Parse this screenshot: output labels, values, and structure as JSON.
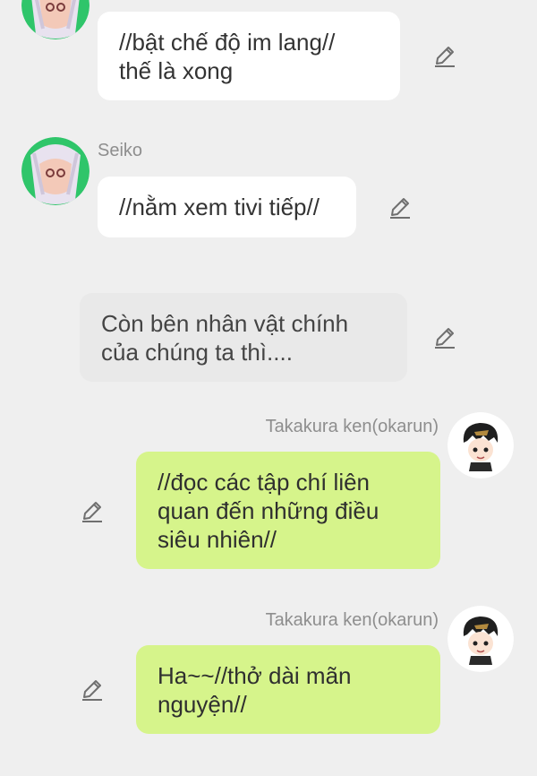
{
  "messages": [
    {
      "sender": "",
      "text": "//bật chế độ im lang//\nthế là xong"
    },
    {
      "sender": "Seiko",
      "text": "//nằm xem tivi tiếp//"
    },
    {
      "sender": "",
      "text": "Còn bên nhân vật chính\ncủa chúng ta thì...."
    },
    {
      "sender": "Takakura ken(okarun)",
      "text": "//đọc các tập chí liên\nquan đến những điều\nsiêu nhiên//"
    },
    {
      "sender": "Takakura ken(okarun)",
      "text": "Ha~~//thở dài mãn\nnguyện//"
    }
  ],
  "colors": {
    "background": "#efefef",
    "incoming_bubble": "#ffffff",
    "narration_bubble": "#e9e9e9",
    "outgoing_bubble": "#d6f48b",
    "sender_text": "#8e8e8e"
  },
  "icons": [
    "edit-pencil-icon"
  ]
}
